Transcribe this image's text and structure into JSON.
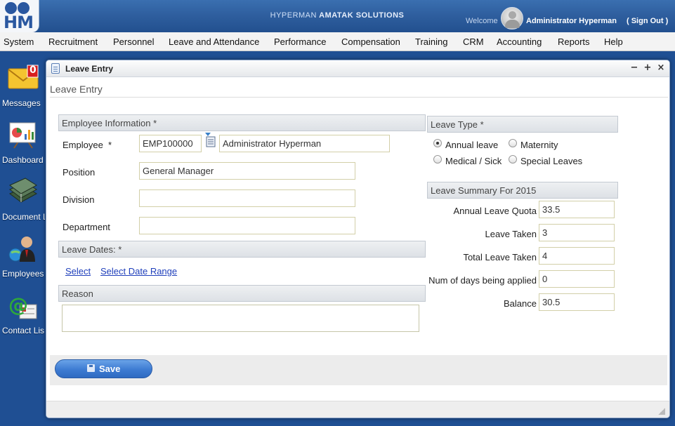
{
  "header": {
    "logo_text": "HM",
    "app_title_light": "HYPERMAN",
    "app_title_bold": "AMATAK SOLUTIONS",
    "welcome": "Welcome",
    "user_name": "Administrator Hyperman",
    "sign_out": "( Sign Out )"
  },
  "menu": [
    "System",
    "Recruitment",
    "Personnel",
    "Leave and Attendance",
    "Performance",
    "Compensation",
    "Training",
    "CRM",
    "Accounting",
    "Reports",
    "Help"
  ],
  "desktop": {
    "messages": {
      "label": "Messages",
      "badge": "0"
    },
    "dashboard": {
      "label": "Dashboard"
    },
    "document": {
      "label": "Document L"
    },
    "employees": {
      "label": "Employees"
    },
    "contacts": {
      "label": "Contact Lis"
    }
  },
  "window": {
    "title": "Leave Entry",
    "heading": "Leave Entry",
    "controls": {
      "minimize": "−",
      "maximize": "+",
      "close": "×"
    }
  },
  "employee_info": {
    "section_title": "Employee Information *",
    "employee_label": "Employee",
    "required_marker": "*",
    "employee_id": "EMP100000",
    "employee_name": "Administrator Hyperman",
    "position_label": "Position",
    "position_value": "General Manager",
    "division_label": "Division",
    "division_value": "",
    "department_label": "Department",
    "department_value": ""
  },
  "leave_dates": {
    "section_title": "Leave Dates: *",
    "select_link": "Select",
    "range_link": "Select Date Range"
  },
  "reason": {
    "section_title": "Reason",
    "value": ""
  },
  "leave_type": {
    "section_title": "Leave Type  *",
    "options": [
      {
        "label": "Annual leave",
        "checked": true
      },
      {
        "label": "Maternity",
        "checked": false
      },
      {
        "label": "Medical / Sick",
        "checked": false
      },
      {
        "label": "Special Leaves",
        "checked": false
      }
    ]
  },
  "summary": {
    "section_title": "Leave Summary For 2015",
    "rows": [
      {
        "label": "Annual Leave Quota",
        "value": "33.5"
      },
      {
        "label": "Leave Taken",
        "value": "3"
      },
      {
        "label": "Total Leave Taken",
        "value": "4"
      },
      {
        "label": "Num of days being applied",
        "value": "0"
      },
      {
        "label": "Balance",
        "value": "30.5"
      }
    ]
  },
  "actions": {
    "save_label": "Save"
  }
}
